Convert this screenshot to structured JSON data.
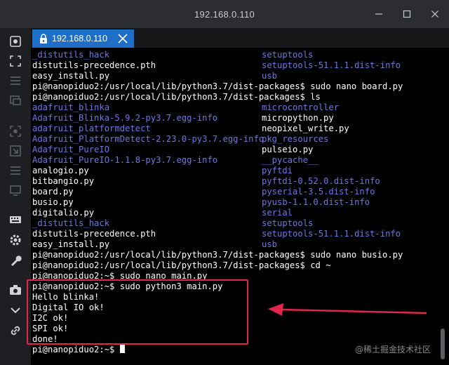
{
  "window": {
    "title": "192.168.0.110"
  },
  "tab": {
    "label": "192.168.0.110"
  },
  "sidebar": {
    "icons": [
      "screenshot-icon",
      "fullscreen-icon",
      "menu-icon",
      "files-icon",
      "capture-icon",
      "resize-icon",
      "list-icon",
      "monitor-icon",
      "keyboard-icon",
      "settings-icon",
      "wrench-icon",
      "camera-icon",
      "chevron-down-icon",
      "link-icon"
    ]
  },
  "terminal": {
    "rows": [
      {
        "left": "_distutils_hack",
        "left_color": "cyan",
        "right": "setuptools",
        "right_color": "cyan"
      },
      {
        "left": "distutils-precedence.pth",
        "left_color": "white",
        "right": "setuptools-51.1.1.dist-info",
        "right_color": "cyan"
      },
      {
        "left": "easy_install.py",
        "left_color": "white",
        "right": "usb",
        "right_color": "cyan"
      },
      {
        "text": "pi@nanopiduo2:/usr/local/lib/python3.7/dist-packages$ sudo nano board.py"
      },
      {
        "text": "pi@nanopiduo2:/usr/local/lib/python3.7/dist-packages$ ls"
      },
      {
        "left": "adafruit_blinka",
        "left_color": "cyan",
        "right": "microcontroller",
        "right_color": "cyan"
      },
      {
        "left": "Adafruit_Blinka-5.9.2-py3.7.egg-info",
        "left_color": "cyan",
        "right": "micropython.py",
        "right_color": "white"
      },
      {
        "left": "adafruit_platformdetect",
        "left_color": "cyan",
        "right": "neopixel_write.py",
        "right_color": "white"
      },
      {
        "left": "Adafruit_PlatformDetect-2.23.0-py3.7.egg-info",
        "left_color": "cyan",
        "right": "pkg_resources",
        "right_color": "cyan"
      },
      {
        "left": "Adafruit_PureIO",
        "left_color": "cyan",
        "right": "pulseio.py",
        "right_color": "white"
      },
      {
        "left": "Adafruit_PureIO-1.1.8-py3.7.egg-info",
        "left_color": "cyan",
        "right": "__pycache__",
        "right_color": "cyan"
      },
      {
        "left": "analogio.py",
        "left_color": "white",
        "right": "pyftdi",
        "right_color": "cyan"
      },
      {
        "left": "bitbangio.py",
        "left_color": "white",
        "right": "pyftdi-0.52.0.dist-info",
        "right_color": "cyan"
      },
      {
        "left": "board.py",
        "left_color": "white",
        "right": "pyserial-3.5.dist-info",
        "right_color": "cyan"
      },
      {
        "left": "busio.py",
        "left_color": "white",
        "right": "pyusb-1.1.0.dist-info",
        "right_color": "cyan"
      },
      {
        "left": "digitalio.py",
        "left_color": "white",
        "right": "serial",
        "right_color": "cyan"
      },
      {
        "left": "_distutils_hack",
        "left_color": "cyan",
        "right": "setuptools",
        "right_color": "cyan"
      },
      {
        "left": "distutils-precedence.pth",
        "left_color": "white",
        "right": "setuptools-51.1.1.dist-info",
        "right_color": "cyan"
      },
      {
        "left": "easy_install.py",
        "left_color": "white",
        "right": "usb",
        "right_color": "cyan"
      },
      {
        "text": "pi@nanopiduo2:/usr/local/lib/python3.7/dist-packages$ sudo nano busio.py"
      },
      {
        "text": "pi@nanopiduo2:/usr/local/lib/python3.7/dist-packages$ cd ~"
      },
      {
        "text": "pi@nanopiduo2:~$ sudo nano main.py"
      },
      {
        "text": "pi@nanopiduo2:~$ sudo python3 main.py"
      },
      {
        "text": "Hello blinka!"
      },
      {
        "text": "Digital IO ok!"
      },
      {
        "text": "I2C ok!"
      },
      {
        "text": "SPI ok!"
      },
      {
        "text": "done!"
      },
      {
        "text": "pi@nanopiduo2:~$ ",
        "cursor": true
      }
    ]
  },
  "colors": {
    "accent_tab": "#1f6fc8",
    "listing_dir": "#6e75e8",
    "annotation": "#e0264a"
  },
  "watermark": "@稀土掘金技术社区"
}
